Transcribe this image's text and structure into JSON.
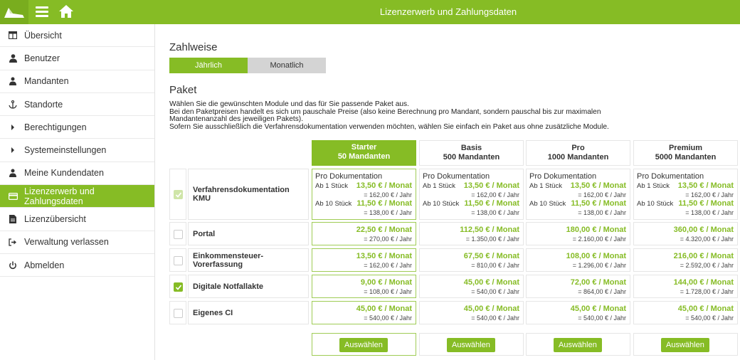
{
  "header": {
    "title": "Lizenzerwerb und Zahlungsdaten",
    "icons": [
      "logo-icon",
      "menu-icon",
      "home-icon"
    ]
  },
  "sidebar": {
    "items": [
      {
        "label": "Übersicht",
        "icon": "table-icon",
        "active": false
      },
      {
        "label": "Benutzer",
        "icon": "user-icon",
        "active": false
      },
      {
        "label": "Mandanten",
        "icon": "users-icon",
        "active": false
      },
      {
        "label": "Standorte",
        "icon": "anchor-icon",
        "active": false
      },
      {
        "label": "Berechtigungen",
        "icon": "caret-right-icon",
        "active": false
      },
      {
        "label": "Systemeinstellungen",
        "icon": "caret-right-icon",
        "active": false
      },
      {
        "label": "Meine Kundendaten",
        "icon": "users-icon",
        "active": false
      },
      {
        "label": "Lizenzerwerb und Zahlungsdaten",
        "icon": "credit-card-icon",
        "active": true
      },
      {
        "label": "Lizenzübersicht",
        "icon": "document-icon",
        "active": false
      },
      {
        "label": "Verwaltung verlassen",
        "icon": "sign-out-icon",
        "active": false
      },
      {
        "label": "Abmelden",
        "icon": "power-icon",
        "active": false
      }
    ]
  },
  "payment": {
    "heading": "Zahlweise",
    "options": [
      {
        "label": "Jährlich",
        "selected": true
      },
      {
        "label": "Monatlich",
        "selected": false
      }
    ]
  },
  "package": {
    "heading": "Paket",
    "description": [
      "Wählen Sie die gewünschten Module und das für Sie passende Paket aus.",
      "Bei den Paketpreisen handelt es sich um pauschale Preise (also keine Berechnung pro Mandant, sondern pauschal bis zur maximalen",
      "Mandantenanzahl des jeweiligen Pakets).",
      "Sofern Sie ausschließlich die Verfahrensdokumentation verwenden möchten, wählen Sie einfach ein Paket aus ohne zusätzliche Module."
    ],
    "plans": [
      {
        "name": "Starter",
        "mandanten": "50 Mandanten",
        "selected": true
      },
      {
        "name": "Basis",
        "mandanten": "500 Mandanten",
        "selected": false
      },
      {
        "name": "Pro",
        "mandanten": "1000 Mandanten",
        "selected": false
      },
      {
        "name": "Premium",
        "mandanten": "5000 Mandanten",
        "selected": false
      }
    ],
    "doc_module": {
      "name": "Verfahrensdokumentation KMU",
      "checked": true,
      "disabled": true,
      "title": "Pro Dokumentation",
      "tier1_label": "Ab 1 Stück",
      "tier1_month": "13,50 € / Monat",
      "tier1_year": "= 162,00 € / Jahr",
      "tier10_label": "Ab 10 Stück",
      "tier10_month": "11,50 € / Monat",
      "tier10_year": "= 138,00 € / Jahr"
    },
    "modules": [
      {
        "name": "Portal",
        "checked": false,
        "prices": [
          {
            "month": "22,50 € / Monat",
            "year": "= 270,00 € / Jahr"
          },
          {
            "month": "112,50 € / Monat",
            "year": "= 1.350,00 € / Jahr"
          },
          {
            "month": "180,00 € / Monat",
            "year": "= 2.160,00 € / Jahr"
          },
          {
            "month": "360,00 € / Monat",
            "year": "= 4.320,00 € / Jahr"
          }
        ]
      },
      {
        "name": "Einkommensteuer-Vorerfassung",
        "checked": false,
        "prices": [
          {
            "month": "13,50 € / Monat",
            "year": "= 162,00 € / Jahr"
          },
          {
            "month": "67,50 € / Monat",
            "year": "= 810,00 € / Jahr"
          },
          {
            "month": "108,00 € / Monat",
            "year": "= 1.296,00 € / Jahr"
          },
          {
            "month": "216,00 € / Monat",
            "year": "= 2.592,00 € / Jahr"
          }
        ]
      },
      {
        "name": "Digitale Notfallakte",
        "checked": true,
        "prices": [
          {
            "month": "9,00 € / Monat",
            "year": "= 108,00 € / Jahr"
          },
          {
            "month": "45,00 € / Monat",
            "year": "= 540,00 € / Jahr"
          },
          {
            "month": "72,00 € / Monat",
            "year": "= 864,00 € / Jahr"
          },
          {
            "month": "144,00 € / Monat",
            "year": "= 1.728,00 € / Jahr"
          }
        ]
      },
      {
        "name": "Eigenes CI",
        "checked": false,
        "prices": [
          {
            "month": "45,00 € / Monat",
            "year": "= 540,00 € / Jahr"
          },
          {
            "month": "45,00 € / Monat",
            "year": "= 540,00 € / Jahr"
          },
          {
            "month": "45,00 € / Monat",
            "year": "= 540,00 € / Jahr"
          },
          {
            "month": "45,00 € / Monat",
            "year": "= 540,00 € / Jahr"
          }
        ]
      }
    ],
    "select_label": "Auswählen"
  },
  "colors": {
    "accent": "#86bc25",
    "accent_dark": "#79ad1e",
    "toggle_off": "#d4d4d4"
  }
}
